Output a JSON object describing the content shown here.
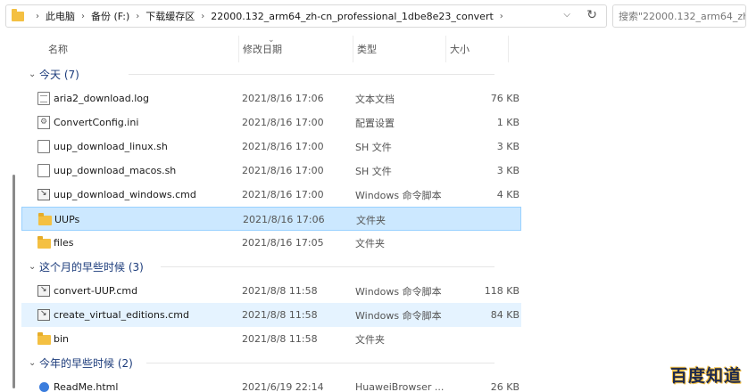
{
  "address": {
    "crumbs": [
      "此电脑",
      "备份 (F:)",
      "下载缓存区",
      "22000.132_arm64_zh-cn_professional_1dbe8e23_convert"
    ]
  },
  "search": {
    "placeholder": "搜索\"22000.132_arm64_zh-c..."
  },
  "columns": {
    "name": "名称",
    "date": "修改日期",
    "type": "类型",
    "size": "大小"
  },
  "groups": [
    {
      "label": "今天 (7)",
      "items": [
        {
          "name": "aria2_download.log",
          "date": "2021/8/16 17:06",
          "type": "文本文档",
          "size": "76 KB",
          "icon": "text-file-icon"
        },
        {
          "name": "ConvertConfig.ini",
          "date": "2021/8/16 17:00",
          "type": "配置设置",
          "size": "1 KB",
          "icon": "config-file-icon"
        },
        {
          "name": "uup_download_linux.sh",
          "date": "2021/8/16 17:00",
          "type": "SH 文件",
          "size": "3 KB",
          "icon": "file-icon"
        },
        {
          "name": "uup_download_macos.sh",
          "date": "2021/8/16 17:00",
          "type": "SH 文件",
          "size": "3 KB",
          "icon": "file-icon"
        },
        {
          "name": "uup_download_windows.cmd",
          "date": "2021/8/16 17:00",
          "type": "Windows 命令脚本",
          "size": "4 KB",
          "icon": "cmd-script-icon"
        },
        {
          "name": "UUPs",
          "date": "2021/8/16 17:06",
          "type": "文件夹",
          "size": "",
          "icon": "folder-icon"
        },
        {
          "name": "files",
          "date": "2021/8/16 17:05",
          "type": "文件夹",
          "size": "",
          "icon": "folder-icon"
        }
      ]
    },
    {
      "label": "这个月的早些时候 (3)",
      "items": [
        {
          "name": "convert-UUP.cmd",
          "date": "2021/8/8 11:58",
          "type": "Windows 命令脚本",
          "size": "118 KB",
          "icon": "cmd-script-icon"
        },
        {
          "name": "create_virtual_editions.cmd",
          "date": "2021/8/8 11:58",
          "type": "Windows 命令脚本",
          "size": "84 KB",
          "icon": "cmd-script-icon"
        },
        {
          "name": "bin",
          "date": "2021/8/8 11:58",
          "type": "文件夹",
          "size": "",
          "icon": "folder-icon"
        }
      ]
    },
    {
      "label": "今年的早些时候 (2)",
      "items": [
        {
          "name": "ReadMe.html",
          "date": "2021/6/19 22:14",
          "type": "HuaweiBrowser ...",
          "size": "26 KB",
          "icon": "html-file-icon"
        }
      ]
    }
  ],
  "watermark": {
    "text": "百度知道"
  }
}
